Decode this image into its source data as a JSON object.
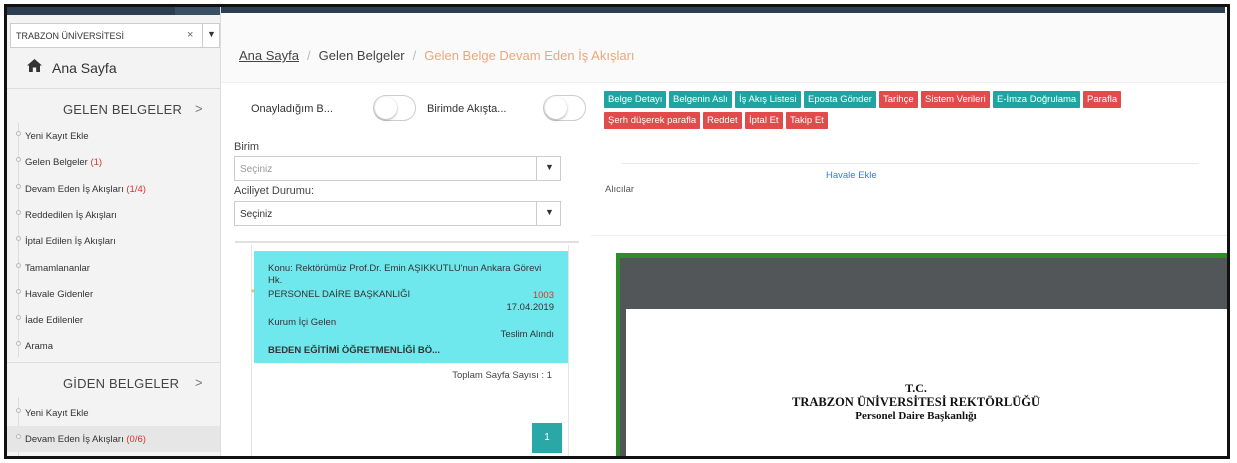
{
  "sidebar": {
    "institution": "TRABZON ÜNİVERSİTESİ",
    "clear_symbol": "×",
    "caret_symbol": "▼",
    "home_label": "Ana Sayfa",
    "home_icon": "home-icon",
    "incoming_section": "GELEN BELGELER",
    "incoming_items": [
      {
        "label": "Yeni Kayıt Ekle",
        "count": ""
      },
      {
        "label": "Gelen Belgeler ",
        "count": "(1)"
      },
      {
        "label": "Devam Eden İş Akışları ",
        "count": "(1/4)"
      },
      {
        "label": "Reddedilen İş Akışları",
        "count": ""
      },
      {
        "label": "İptal Edilen İş Akışları",
        "count": ""
      },
      {
        "label": "Tamamlananlar",
        "count": ""
      },
      {
        "label": "Havale Gidenler",
        "count": ""
      },
      {
        "label": "İade Edilenler",
        "count": ""
      },
      {
        "label": "Arama",
        "count": ""
      }
    ],
    "outgoing_section": "GİDEN BELGELER",
    "outgoing_items": [
      {
        "label": "Yeni Kayıt Ekle",
        "count": ""
      },
      {
        "label": "Devam Eden İş Akışları ",
        "count": "(0/6)"
      }
    ],
    "chevron": ">"
  },
  "breadcrumb": {
    "home": "Ana Sayfa",
    "level1": "Gelen Belgeler",
    "current": "Gelen Belge Devam Eden İş Akışları",
    "separator": "/"
  },
  "filters": {
    "toggle1_label": "Onayladığım B...",
    "toggle2_label": "Birimde Akışta...",
    "unit_label": "Birim",
    "unit_placeholder": "Seçiniz",
    "urgency_label": "Aciliyet Durumu:",
    "urgency_value": "Seçiniz"
  },
  "card": {
    "subject": "Konu: Rektörümüz Prof.Dr. Emin AŞIKKUTLU'nun Ankara Görevi Hk.",
    "department": "PERSONEL DAİRE BAŞKANLIĞI",
    "number": "1003",
    "date": "17.04.2019",
    "type": "Kurum İçi Gelen",
    "status": "Teslim Alındı",
    "unit": "BEDEN EĞİTİMİ ÖĞRETMENLİĞİ BÖ...",
    "star": "*"
  },
  "pagination": {
    "total_pages_label": "Toplam Sayfa Sayısı : 1",
    "page": "1"
  },
  "actions": {
    "row1": [
      {
        "label": "Belge Detayı",
        "style": "teal"
      },
      {
        "label": "Belgenin Aslı",
        "style": "teal"
      },
      {
        "label": "İş Akış Listesi",
        "style": "teal"
      },
      {
        "label": "Eposta Gönder",
        "style": "teal"
      },
      {
        "label": "Tarihçe",
        "style": "red"
      },
      {
        "label": "Sistem Verileri",
        "style": "red"
      },
      {
        "label": "E-İmza Doğrulama",
        "style": "teal"
      },
      {
        "label": "Parafla",
        "style": "red"
      }
    ],
    "row2": [
      {
        "label": "Şerh düşerek parafla",
        "style": "red"
      },
      {
        "label": "Reddet",
        "style": "red"
      },
      {
        "label": "İptal Et",
        "style": "red"
      },
      {
        "label": "Takip Et",
        "style": "red"
      }
    ],
    "recipients_label": "Alıcılar",
    "add_referral": "Havale Ekle"
  },
  "document": {
    "line1": "T.C.",
    "line2": "TRABZON ÜNİVERSİTESİ REKTÖRLÜĞÜ",
    "line3": "Personel Daire Başkanlığı"
  },
  "colors": {
    "teal": "#1fa3a3",
    "red": "#e14b4b",
    "card": "#6ee8ec",
    "count": "#d9342b",
    "crumb_current": "#e8a87c"
  }
}
